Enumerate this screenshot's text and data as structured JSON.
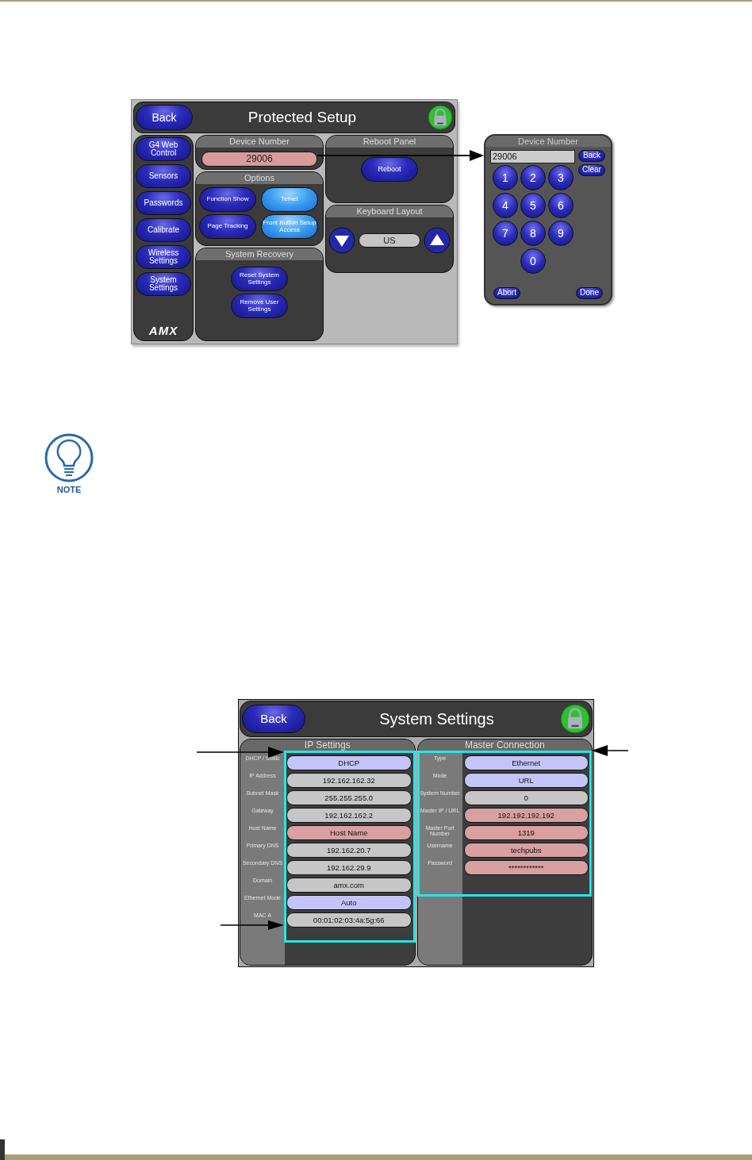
{
  "protected_setup": {
    "back": "Back",
    "title": "Protected Setup",
    "nav": [
      "G4 Web Control",
      "Sensors",
      "Passwords",
      "Calibrate",
      "Wireless Settings",
      "System Settings"
    ],
    "logo": "AMX",
    "device_number": {
      "title": "Device Number",
      "value": "29006"
    },
    "options": {
      "title": "Options",
      "buttons": [
        {
          "label": "Function Show",
          "on": false
        },
        {
          "label": "Telnet",
          "on": true
        },
        {
          "label": "Page Tracking",
          "on": false
        },
        {
          "label": "Front Button Setup Access",
          "on": true
        }
      ]
    },
    "system_recovery": {
      "title": "System Recovery",
      "buttons": [
        "Reset System Settings",
        "Remove User Settings"
      ]
    },
    "reboot_panel": {
      "title": "Reboot Panel",
      "button": "Reboot"
    },
    "keyboard_layout": {
      "title": "Keyboard Layout",
      "value": "US"
    }
  },
  "keypad": {
    "title": "Device Number",
    "value": "29006",
    "back": "Back",
    "clear": "Clear",
    "keys": [
      "1",
      "2",
      "3",
      "4",
      "5",
      "6",
      "7",
      "8",
      "9",
      "0"
    ],
    "abort": "Abort",
    "done": "Done"
  },
  "note": {
    "label": "NOTE"
  },
  "system_settings": {
    "back": "Back",
    "title": "System Settings",
    "ip_settings": {
      "title": "IP Settings",
      "rows": [
        {
          "label": "DHCP / Static",
          "value": "DHCP",
          "kind": "select"
        },
        {
          "label": "IP Address",
          "value": "192.162.162.32",
          "kind": "display"
        },
        {
          "label": "Subnet Mask",
          "value": "255.255.255.0",
          "kind": "display"
        },
        {
          "label": "Gateway",
          "value": "192.162.162.2",
          "kind": "display"
        },
        {
          "label": "Host Name",
          "value": "Host Name",
          "kind": "edit"
        },
        {
          "label": "Primary DNS",
          "value": "192.162.20.7",
          "kind": "display"
        },
        {
          "label": "Secondary DNS",
          "value": "192.162.29.9",
          "kind": "display"
        },
        {
          "label": "Domain",
          "value": "amx.com",
          "kind": "display"
        },
        {
          "label": "Ethernet Mode",
          "value": "Auto",
          "kind": "select"
        },
        {
          "label": "MAC A",
          "value": "00:01:02:03:4a:5g:66",
          "kind": "display"
        }
      ]
    },
    "master_connection": {
      "title": "Master Connection",
      "rows": [
        {
          "label": "Type",
          "value": "Ethernet",
          "kind": "select"
        },
        {
          "label": "Mode",
          "value": "URL",
          "kind": "select"
        },
        {
          "label": "System Number",
          "value": "0",
          "kind": "display"
        },
        {
          "label": "Master IP / URL",
          "value": "192.192.192.192",
          "kind": "edit"
        },
        {
          "label": "Master Port Number",
          "value": "1319",
          "kind": "edit"
        },
        {
          "label": "Username",
          "value": "techpubs",
          "kind": "edit"
        },
        {
          "label": "Password",
          "value": "************",
          "kind": "edit"
        }
      ]
    }
  }
}
